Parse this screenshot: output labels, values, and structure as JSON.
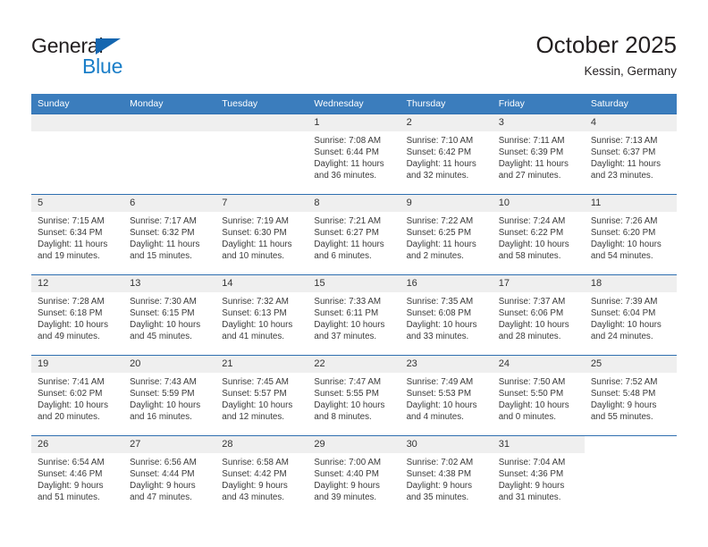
{
  "brand": {
    "name_top": "General",
    "name_bottom": "Blue",
    "color_dark": "#231f20",
    "color_blue": "#1a7ec8",
    "triangle_color": "#1466b0"
  },
  "header": {
    "title": "October 2025",
    "subtitle": "Kessin, Germany"
  },
  "theme": {
    "header_row_bg": "#3b7dbd",
    "header_row_text": "#ffffff",
    "week_divider": "#2f6fb0",
    "daynum_bg": "#efefef"
  },
  "weekdays": [
    "Sunday",
    "Monday",
    "Tuesday",
    "Wednesday",
    "Thursday",
    "Friday",
    "Saturday"
  ],
  "weeks": [
    [
      {
        "day": "",
        "lines": []
      },
      {
        "day": "",
        "lines": []
      },
      {
        "day": "",
        "lines": []
      },
      {
        "day": "1",
        "lines": [
          "Sunrise: 7:08 AM",
          "Sunset: 6:44 PM",
          "Daylight: 11 hours",
          "and 36 minutes."
        ]
      },
      {
        "day": "2",
        "lines": [
          "Sunrise: 7:10 AM",
          "Sunset: 6:42 PM",
          "Daylight: 11 hours",
          "and 32 minutes."
        ]
      },
      {
        "day": "3",
        "lines": [
          "Sunrise: 7:11 AM",
          "Sunset: 6:39 PM",
          "Daylight: 11 hours",
          "and 27 minutes."
        ]
      },
      {
        "day": "4",
        "lines": [
          "Sunrise: 7:13 AM",
          "Sunset: 6:37 PM",
          "Daylight: 11 hours",
          "and 23 minutes."
        ]
      }
    ],
    [
      {
        "day": "5",
        "lines": [
          "Sunrise: 7:15 AM",
          "Sunset: 6:34 PM",
          "Daylight: 11 hours",
          "and 19 minutes."
        ]
      },
      {
        "day": "6",
        "lines": [
          "Sunrise: 7:17 AM",
          "Sunset: 6:32 PM",
          "Daylight: 11 hours",
          "and 15 minutes."
        ]
      },
      {
        "day": "7",
        "lines": [
          "Sunrise: 7:19 AM",
          "Sunset: 6:30 PM",
          "Daylight: 11 hours",
          "and 10 minutes."
        ]
      },
      {
        "day": "8",
        "lines": [
          "Sunrise: 7:21 AM",
          "Sunset: 6:27 PM",
          "Daylight: 11 hours",
          "and 6 minutes."
        ]
      },
      {
        "day": "9",
        "lines": [
          "Sunrise: 7:22 AM",
          "Sunset: 6:25 PM",
          "Daylight: 11 hours",
          "and 2 minutes."
        ]
      },
      {
        "day": "10",
        "lines": [
          "Sunrise: 7:24 AM",
          "Sunset: 6:22 PM",
          "Daylight: 10 hours",
          "and 58 minutes."
        ]
      },
      {
        "day": "11",
        "lines": [
          "Sunrise: 7:26 AM",
          "Sunset: 6:20 PM",
          "Daylight: 10 hours",
          "and 54 minutes."
        ]
      }
    ],
    [
      {
        "day": "12",
        "lines": [
          "Sunrise: 7:28 AM",
          "Sunset: 6:18 PM",
          "Daylight: 10 hours",
          "and 49 minutes."
        ]
      },
      {
        "day": "13",
        "lines": [
          "Sunrise: 7:30 AM",
          "Sunset: 6:15 PM",
          "Daylight: 10 hours",
          "and 45 minutes."
        ]
      },
      {
        "day": "14",
        "lines": [
          "Sunrise: 7:32 AM",
          "Sunset: 6:13 PM",
          "Daylight: 10 hours",
          "and 41 minutes."
        ]
      },
      {
        "day": "15",
        "lines": [
          "Sunrise: 7:33 AM",
          "Sunset: 6:11 PM",
          "Daylight: 10 hours",
          "and 37 minutes."
        ]
      },
      {
        "day": "16",
        "lines": [
          "Sunrise: 7:35 AM",
          "Sunset: 6:08 PM",
          "Daylight: 10 hours",
          "and 33 minutes."
        ]
      },
      {
        "day": "17",
        "lines": [
          "Sunrise: 7:37 AM",
          "Sunset: 6:06 PM",
          "Daylight: 10 hours",
          "and 28 minutes."
        ]
      },
      {
        "day": "18",
        "lines": [
          "Sunrise: 7:39 AM",
          "Sunset: 6:04 PM",
          "Daylight: 10 hours",
          "and 24 minutes."
        ]
      }
    ],
    [
      {
        "day": "19",
        "lines": [
          "Sunrise: 7:41 AM",
          "Sunset: 6:02 PM",
          "Daylight: 10 hours",
          "and 20 minutes."
        ]
      },
      {
        "day": "20",
        "lines": [
          "Sunrise: 7:43 AM",
          "Sunset: 5:59 PM",
          "Daylight: 10 hours",
          "and 16 minutes."
        ]
      },
      {
        "day": "21",
        "lines": [
          "Sunrise: 7:45 AM",
          "Sunset: 5:57 PM",
          "Daylight: 10 hours",
          "and 12 minutes."
        ]
      },
      {
        "day": "22",
        "lines": [
          "Sunrise: 7:47 AM",
          "Sunset: 5:55 PM",
          "Daylight: 10 hours",
          "and 8 minutes."
        ]
      },
      {
        "day": "23",
        "lines": [
          "Sunrise: 7:49 AM",
          "Sunset: 5:53 PM",
          "Daylight: 10 hours",
          "and 4 minutes."
        ]
      },
      {
        "day": "24",
        "lines": [
          "Sunrise: 7:50 AM",
          "Sunset: 5:50 PM",
          "Daylight: 10 hours",
          "and 0 minutes."
        ]
      },
      {
        "day": "25",
        "lines": [
          "Sunrise: 7:52 AM",
          "Sunset: 5:48 PM",
          "Daylight: 9 hours",
          "and 55 minutes."
        ]
      }
    ],
    [
      {
        "day": "26",
        "lines": [
          "Sunrise: 6:54 AM",
          "Sunset: 4:46 PM",
          "Daylight: 9 hours",
          "and 51 minutes."
        ]
      },
      {
        "day": "27",
        "lines": [
          "Sunrise: 6:56 AM",
          "Sunset: 4:44 PM",
          "Daylight: 9 hours",
          "and 47 minutes."
        ]
      },
      {
        "day": "28",
        "lines": [
          "Sunrise: 6:58 AM",
          "Sunset: 4:42 PM",
          "Daylight: 9 hours",
          "and 43 minutes."
        ]
      },
      {
        "day": "29",
        "lines": [
          "Sunrise: 7:00 AM",
          "Sunset: 4:40 PM",
          "Daylight: 9 hours",
          "and 39 minutes."
        ]
      },
      {
        "day": "30",
        "lines": [
          "Sunrise: 7:02 AM",
          "Sunset: 4:38 PM",
          "Daylight: 9 hours",
          "and 35 minutes."
        ]
      },
      {
        "day": "31",
        "lines": [
          "Sunrise: 7:04 AM",
          "Sunset: 4:36 PM",
          "Daylight: 9 hours",
          "and 31 minutes."
        ]
      },
      {
        "day": "",
        "lines": []
      }
    ]
  ]
}
